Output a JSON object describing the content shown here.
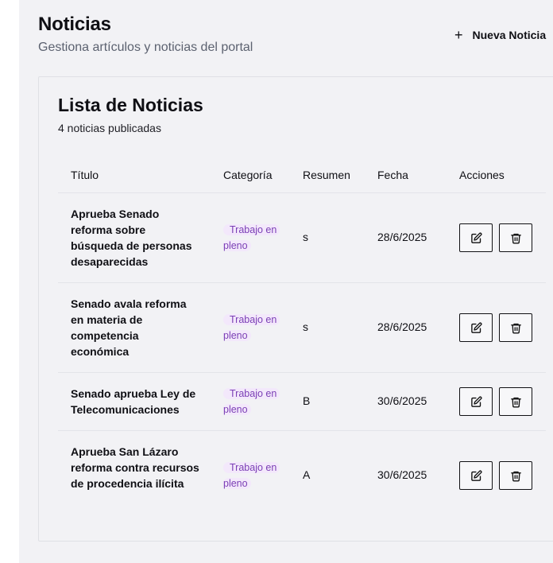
{
  "header": {
    "title": "Noticias",
    "subtitle": "Gestiona artículos y noticias del portal",
    "new_button_icon": "plus-icon",
    "new_button_label": "Nueva Noticia"
  },
  "card": {
    "title": "Lista de Noticias",
    "count": "4 noticias publicadas"
  },
  "table": {
    "columns": {
      "title": "Título",
      "category": "Categoría",
      "summary": "Resumen",
      "date": "Fecha",
      "actions": "Acciones"
    },
    "rows": [
      {
        "title": "Aprueba Senado reforma sobre búsqueda de personas desaparecidas",
        "category": {
          "line1": "Trabajo en",
          "line2": "pleno"
        },
        "summary": "s",
        "date": "28/6/2025"
      },
      {
        "title": "Senado avala reforma en materia de competencia económica",
        "category": {
          "line1": "Trabajo en",
          "line2": "pleno"
        },
        "summary": "s",
        "date": "28/6/2025"
      },
      {
        "title": "Senado aprueba Ley de Telecomunicaciones",
        "category": {
          "line1": "Trabajo en",
          "line2": "pleno"
        },
        "summary": "B",
        "date": "30/6/2025"
      },
      {
        "title": "Aprueba San Lázaro reforma contra recursos de procedencia ilícita",
        "category": {
          "line1": "Trabajo en",
          "line2": "pleno"
        },
        "summary": "A",
        "date": "30/6/2025"
      }
    ]
  },
  "icons": {
    "edit": "edit-icon",
    "delete": "trash-icon"
  },
  "colors": {
    "background": "#f2f2f5",
    "badge_text": "#7b3fb5",
    "badge_bg": "#f3e8fb",
    "scroll_accent": "#4b2e84"
  }
}
